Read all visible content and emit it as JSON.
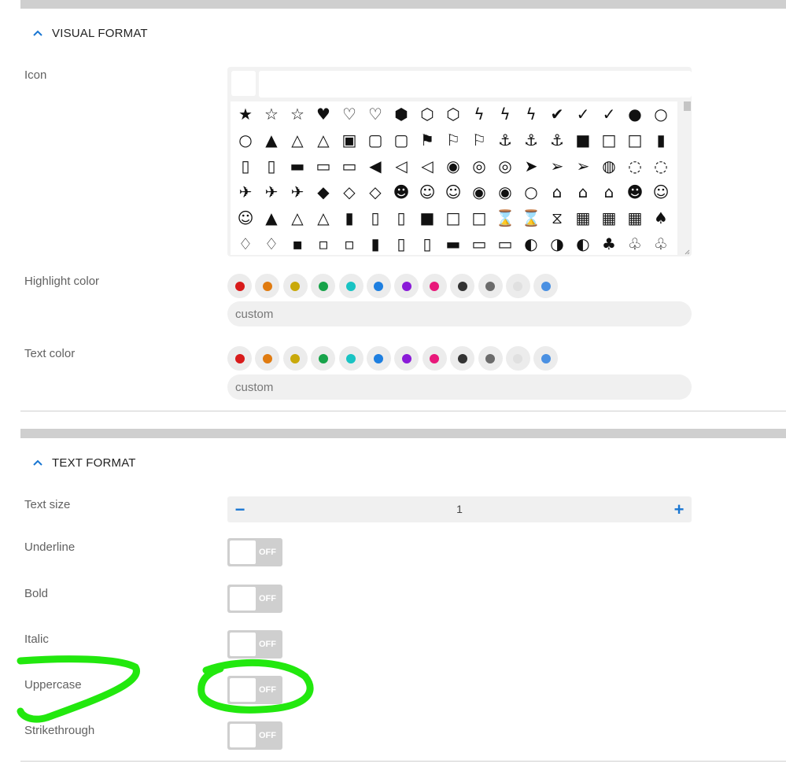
{
  "sections": {
    "visual": {
      "title": "VISUAL FORMAT"
    },
    "text": {
      "title": "TEXT FORMAT"
    }
  },
  "labels": {
    "icon": "Icon",
    "highlight_color": "Highlight color",
    "text_color": "Text color",
    "text_size": "Text size",
    "underline": "Underline",
    "bold": "Bold",
    "italic": "Italic",
    "uppercase": "Uppercase",
    "strikethrough": "Strikethrough"
  },
  "icon_picker": {
    "search_value": "",
    "icons": [
      [
        "★",
        "☆",
        "☆",
        "♥",
        "♡",
        "♡",
        "⬢",
        "⬡",
        "⬡",
        "ϟ",
        "ϟ",
        "ϟ",
        "✔",
        "✓",
        "✓",
        "●",
        "○"
      ],
      [
        "○",
        "▲",
        "△",
        "△",
        "▣",
        "▢",
        "▢",
        "⚑",
        "⚐",
        "⚐",
        "⚓",
        "⚓",
        "⚓",
        "■",
        "□",
        "□",
        "▮"
      ],
      [
        "▯",
        "▯",
        "▬",
        "▭",
        "▭",
        "◀",
        "◁",
        "◁",
        "◉",
        "◎",
        "◎",
        "➤",
        "➢",
        "➢",
        "◍",
        "◌",
        "◌"
      ],
      [
        "✈",
        "✈",
        "✈",
        "◆",
        "◇",
        "◇",
        "☻",
        "☺",
        "☺",
        "◉",
        "◉",
        "○",
        "⌂",
        "⌂",
        "⌂",
        "☻",
        "☺"
      ],
      [
        "☺",
        "▲",
        "△",
        "△",
        "▮",
        "▯",
        "▯",
        "■",
        "□",
        "□",
        "⌛",
        "⌛",
        "⧖",
        "▦",
        "▦",
        "▦",
        "♠"
      ],
      [
        "♢",
        "♢",
        "▪",
        "▫",
        "▫",
        "▮",
        "▯",
        "▯",
        "▬",
        "▭",
        "▭",
        "◐",
        "◑",
        "◐",
        "♣",
        "♧",
        "♧"
      ]
    ],
    "icon_names": [
      "star",
      "star-outline",
      "star-thin",
      "heart",
      "heart-outline",
      "heart-thin",
      "cube",
      "cube-outline",
      "cube-thin",
      "bolt",
      "bolt-outline",
      "bolt-thin",
      "check-circle",
      "check-circle-outline",
      "check-circle-thin",
      "lightbulb",
      "lightbulb-outline",
      "lightbulb-thin",
      "bell",
      "bell-outline",
      "bell-thin",
      "cubes",
      "cubes-outline",
      "cubes-thin",
      "flag",
      "flag-outline",
      "flag-thin",
      "anchor",
      "anchor-outline",
      "anchor-thin",
      "car",
      "car-outline",
      "car-thin",
      "binoculars",
      "binoculars-outline",
      "binoculars-thin",
      "briefcase",
      "briefcase-outline",
      "briefcase-thin",
      "megaphone",
      "megaphone-outline",
      "megaphone-thin",
      "futbol",
      "futbol-outline",
      "futbol-thin",
      "paper-plane",
      "paper-plane-outline",
      "paper-plane-thin",
      "life-ring",
      "life-ring-outline",
      "life-ring-thin",
      "plane",
      "plane-outline",
      "plane-thin",
      "tags",
      "tags-outline",
      "tags-thin",
      "users",
      "users-outline",
      "users-thin",
      "eye",
      "eye-outline",
      "eye-thin",
      "landmark",
      "landmark-outline",
      "landmark-thin",
      "smile",
      "smile-outline",
      "smile-thin",
      "thumbs-up",
      "thumbs-up-outline",
      "thumbs-up-thin",
      "suitcase",
      "suitcase-outline",
      "suitcase-thin",
      "truck",
      "truck-outline",
      "truck-thin",
      "hourglass",
      "hourglass-outline",
      "hourglass-thin",
      "abacus",
      "abacus-outline",
      "abacus-thin",
      "acorn",
      "acorn-outline",
      "acorn-thin",
      "ad",
      "ad-outline",
      "ad-thin",
      "address-book",
      "address-book-outline",
      "address-book-thin",
      "address-card",
      "address-card-outline",
      "address-card-thin",
      "adjust",
      "adjust-outline",
      "adjust-thin",
      "tree",
      "tree-outline",
      "tree-thin"
    ]
  },
  "swatch_colors": [
    "#d81b1b",
    "#e07b10",
    "#c9a90a",
    "#17a34a",
    "#19c3c3",
    "#1e7fe0",
    "#8a1bd8",
    "#e8187a",
    "#333333",
    "#6b6b6b",
    "#e0e0e0",
    "#4a90e2"
  ],
  "highlight_custom_placeholder": "custom",
  "text_custom_placeholder": "custom",
  "text_size": {
    "value": "1",
    "minus": "−",
    "plus": "+"
  },
  "toggles": {
    "underline": "OFF",
    "bold": "OFF",
    "italic": "OFF",
    "uppercase": "OFF",
    "strikethrough": "OFF"
  },
  "colors": {
    "accent": "#1976d2",
    "highlight_marker": "#22e80e"
  }
}
